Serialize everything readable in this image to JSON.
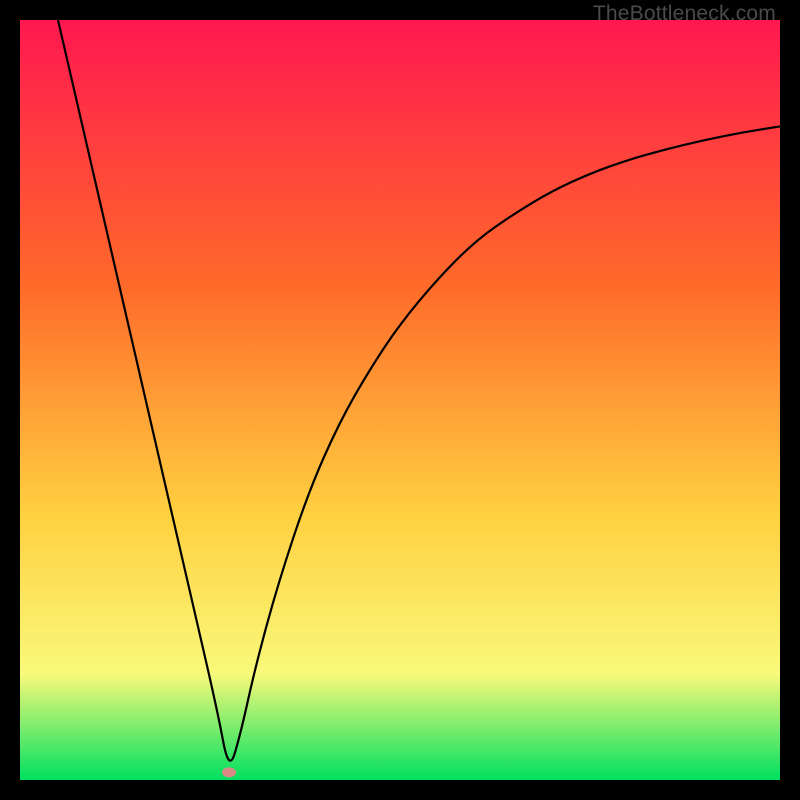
{
  "watermark": "TheBottleneck.com",
  "colors": {
    "gradient_top": "#ff1850",
    "gradient_mid1": "#ff6a2a",
    "gradient_mid2": "#ffd040",
    "gradient_mid3": "#f9f97a",
    "gradient_bottom": "#00e060",
    "curve": "#000000",
    "marker": "#d98a86",
    "frame": "#000000"
  },
  "chart_data": {
    "type": "line",
    "title": "",
    "xlabel": "",
    "ylabel": "",
    "xlim": [
      0,
      100
    ],
    "ylim": [
      0,
      100
    ],
    "notes": "Abstract bottleneck curve on gradient background. No axis ticks or numeric labels are shown; values below are pixel-derived estimates of the depicted curve in 0–100 normalized space (0,0 = bottom-left of plot area).",
    "series": [
      {
        "name": "bottleneck-curve",
        "x": [
          5,
          8,
          11,
          14,
          17,
          20,
          23,
          26,
          27.5,
          29,
          31,
          34,
          38,
          42,
          46,
          50,
          55,
          60,
          65,
          70,
          75,
          80,
          85,
          90,
          95,
          100
        ],
        "y": [
          100,
          87,
          74,
          61,
          48,
          35,
          22,
          9,
          1,
          6,
          15,
          26,
          38,
          47,
          54,
          60,
          66,
          71,
          74.5,
          77.5,
          79.8,
          81.6,
          83,
          84.2,
          85.2,
          86
        ]
      }
    ],
    "marker": {
      "x": 27.5,
      "y": 1,
      "name": "optimal-point"
    }
  }
}
